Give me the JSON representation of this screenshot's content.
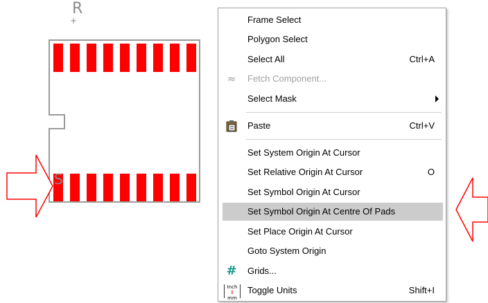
{
  "canvas": {
    "ref_designator": "R",
    "symbol_marker": "S",
    "pad_color": "#ff0000",
    "outline_color": "#9a9a9a",
    "arrow_color": "#ff0000"
  },
  "context_menu": {
    "items": [
      {
        "label": "Frame Select",
        "shortcut": "",
        "icon": ""
      },
      {
        "label": "Polygon Select",
        "shortcut": "",
        "icon": ""
      },
      {
        "label": "Select All",
        "shortcut": "Ctrl+A",
        "icon": ""
      },
      {
        "label": "Fetch Component...",
        "shortcut": "",
        "icon": "fetch-component-icon",
        "disabled": true
      },
      {
        "label": "Select Mask",
        "shortcut": "",
        "icon": "",
        "submenu": true
      },
      {
        "label": "Paste",
        "shortcut": "Ctrl+V",
        "icon": "clipboard-icon"
      },
      {
        "label": "Set System Origin At Cursor",
        "shortcut": "",
        "icon": ""
      },
      {
        "label": "Set Relative Origin At Cursor",
        "shortcut": "O",
        "icon": ""
      },
      {
        "label": "Set Symbol Origin At Cursor",
        "shortcut": "",
        "icon": ""
      },
      {
        "label": "Set Symbol Origin At Centre Of Pads",
        "shortcut": "",
        "icon": "",
        "highlighted": true
      },
      {
        "label": "Set Place Origin At Cursor",
        "shortcut": "",
        "icon": ""
      },
      {
        "label": "Goto System Origin",
        "shortcut": "",
        "icon": ""
      },
      {
        "label": "Grids...",
        "shortcut": "",
        "icon": "grid-icon"
      },
      {
        "label": "Toggle Units",
        "shortcut": "Shift+I",
        "icon": "units-icon"
      }
    ],
    "icon_glyphs": {
      "fetch": "≈",
      "grid": "#",
      "units_top": "Inch",
      "units_bottom": "mm"
    }
  }
}
